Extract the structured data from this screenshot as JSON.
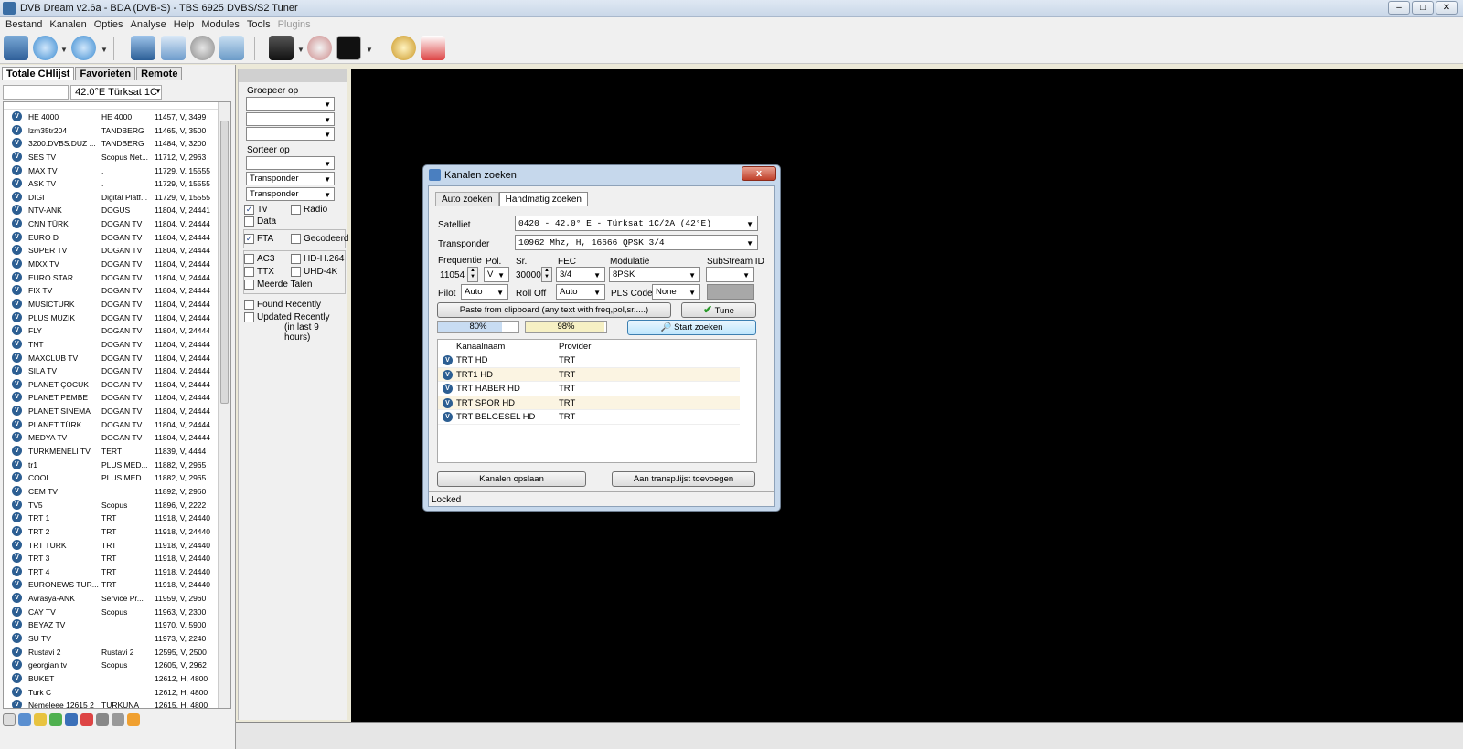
{
  "window": {
    "title": "DVB Dream v2.6a - BDA (DVB-S)  -  TBS 6925 DVBS/S2 Tuner"
  },
  "menu": [
    {
      "label": "Bestand",
      "disabled": false
    },
    {
      "label": "Kanalen",
      "disabled": false
    },
    {
      "label": "Opties",
      "disabled": false
    },
    {
      "label": "Analyse",
      "disabled": false
    },
    {
      "label": "Help",
      "disabled": false
    },
    {
      "label": "Modules",
      "disabled": false
    },
    {
      "label": "Tools",
      "disabled": false
    },
    {
      "label": "Plugins",
      "disabled": true
    }
  ],
  "left": {
    "tabs": [
      "Totale CHlijst",
      "Favorieten",
      "Remote"
    ],
    "satellite": "42.0°E Türksat 1C",
    "channels": [
      [
        "HE 4000",
        "HE 4000",
        "11457, V, 3499"
      ],
      [
        "lzm35tr204",
        "TANDBERG",
        "11465, V, 3500"
      ],
      [
        "3200.DVBS.DUZ ...",
        "TANDBERG",
        "11484, V, 3200"
      ],
      [
        "SES TV",
        "Scopus Net...",
        "11712, V, 2963"
      ],
      [
        "MAX TV",
        ".",
        "11729, V, 15555"
      ],
      [
        "ASK TV",
        ".",
        "11729, V, 15555"
      ],
      [
        "DIGI",
        "Digital Platf...",
        "11729, V, 15555"
      ],
      [
        "NTV-ANK",
        "DOGUS",
        "11804, V, 24441"
      ],
      [
        "CNN TÜRK",
        "DOGAN TV",
        "11804, V, 24444"
      ],
      [
        "EURO D",
        "DOGAN TV",
        "11804, V, 24444"
      ],
      [
        "SUPER TV",
        "DOGAN TV",
        "11804, V, 24444"
      ],
      [
        "MIXX TV",
        "DOGAN TV",
        "11804, V, 24444"
      ],
      [
        "EURO STAR",
        "DOGAN TV",
        "11804, V, 24444"
      ],
      [
        "FIX TV",
        "DOGAN TV",
        "11804, V, 24444"
      ],
      [
        "MUSICTÜRK",
        "DOGAN TV",
        "11804, V, 24444"
      ],
      [
        "PLUS MUZIK",
        "DOGAN TV",
        "11804, V, 24444"
      ],
      [
        "FLY",
        "DOGAN TV",
        "11804, V, 24444"
      ],
      [
        "TNT",
        "DOGAN TV",
        "11804, V, 24444"
      ],
      [
        "MAXCLUB TV",
        "DOGAN TV",
        "11804, V, 24444"
      ],
      [
        "SILA TV",
        "DOGAN TV",
        "11804, V, 24444"
      ],
      [
        "PLANET ÇOCUK",
        "DOGAN TV",
        "11804, V, 24444"
      ],
      [
        "PLANET PEMBE",
        "DOGAN TV",
        "11804, V, 24444"
      ],
      [
        "PLANET SINEMA",
        "DOGAN TV",
        "11804, V, 24444"
      ],
      [
        "PLANET TÜRK",
        "DOGAN TV",
        "11804, V, 24444"
      ],
      [
        "MEDYA TV",
        "DOGAN TV",
        "11804, V, 24444"
      ],
      [
        "TURKMENELI TV",
        "TERT",
        "11839, V, 4444"
      ],
      [
        "tr1",
        "PLUS MED...",
        "11882, V, 2965"
      ],
      [
        "COOL",
        "PLUS MED...",
        "11882, V, 2965"
      ],
      [
        "CEM TV",
        "",
        "11892, V, 2960"
      ],
      [
        "TV5",
        "Scopus",
        "11896, V, 2222"
      ],
      [
        "TRT 1",
        "TRT",
        "11918, V, 24440"
      ],
      [
        "TRT 2",
        "TRT",
        "11918, V, 24440"
      ],
      [
        "TRT TURK",
        "TRT",
        "11918, V, 24440"
      ],
      [
        "TRT 3",
        "TRT",
        "11918, V, 24440"
      ],
      [
        "TRT 4",
        "TRT",
        "11918, V, 24440"
      ],
      [
        "EURONEWS TUR...",
        "TRT",
        "11918, V, 24440"
      ],
      [
        "Avrasya-ANK",
        "Service Pr...",
        "11959, V, 2960"
      ],
      [
        "CAY TV",
        "Scopus",
        "11963, V, 2300"
      ],
      [
        "BEYAZ TV",
        "",
        "11970, V, 5900"
      ],
      [
        "SU TV",
        "",
        "11973, V, 2240"
      ],
      [
        "Rustavi 2",
        "Rustavi 2",
        "12595, V, 2500"
      ],
      [
        "georgian tv",
        "Scopus",
        "12605, V, 2962"
      ],
      [
        "BUKET",
        "",
        "12612, H, 4800"
      ],
      [
        "Turk C",
        "",
        "12612, H, 4800"
      ],
      [
        "Nemeleee 12615 2",
        "TURKUNA",
        "12615, H, 4800"
      ]
    ]
  },
  "filters": {
    "groep_label": "Groepeer op",
    "sorteer_label": "Sorteer op",
    "sort1": "Transponder",
    "sort2": "Transponder",
    "tv": "Tv",
    "radio": "Radio",
    "data": "Data",
    "fta": "FTA",
    "gecodeerd": "Gecodeerd",
    "ac3": "AC3",
    "hd": "HD-H.264",
    "ttx": "TTX",
    "uhd": "UHD-4K",
    "meerdere": "Meerde Talen",
    "found": "Found Recently",
    "updated": "Updated Recently",
    "updated_sub": "(in last 9 hours)"
  },
  "dialog": {
    "title": "Kanalen zoeken",
    "close": "x",
    "tabs": [
      "Auto zoeken",
      "Handmatig zoeken"
    ],
    "satelliet_label": "Satelliet",
    "satelliet_value": "0420 - 42.0° E - Türksat 1C/2A (42°E)",
    "transponder_label": "Transponder",
    "transponder_value": "10962 Mhz, H, 16666  QPSK 3/4",
    "freq_label": "Frequentie",
    "freq_value": "11054",
    "pol_label": "Pol.",
    "pol_value": "V",
    "sr_label": "Sr.",
    "sr_value": "30000",
    "fec_label": "FEC",
    "fec_value": "3/4",
    "mod_label": "Modulatie",
    "mod_value": "8PSK",
    "substream_label": "SubStream ID",
    "substream_value": "",
    "pilot_label": "Pilot",
    "pilot_value": "Auto",
    "rolloff_label": "Roll Off",
    "rolloff_value": "Auto",
    "pls_label": "PLS Code",
    "pls_value": "None",
    "paste_btn": "Paste from clipboard  (any text with freq,pol,sr.....)",
    "tune_btn": "Tune",
    "signal1": "80%",
    "signal1_level": 0.8,
    "signal2": "98%",
    "signal2_level": 0.98,
    "start_btn": "Start zoeken",
    "col_kanaal": "Kanaalnaam",
    "col_provider": "Provider",
    "results": [
      [
        "TRT HD",
        "TRT"
      ],
      [
        "TRT1 HD",
        "TRT"
      ],
      [
        "TRT HABER HD",
        "TRT"
      ],
      [
        "TRT SPOR HD",
        "TRT"
      ],
      [
        "TRT BELGESEL HD",
        "TRT"
      ]
    ],
    "save_btn": "Kanalen opslaan",
    "add_btn": "Aan transp.lijst toevoegen",
    "status": "Locked"
  }
}
